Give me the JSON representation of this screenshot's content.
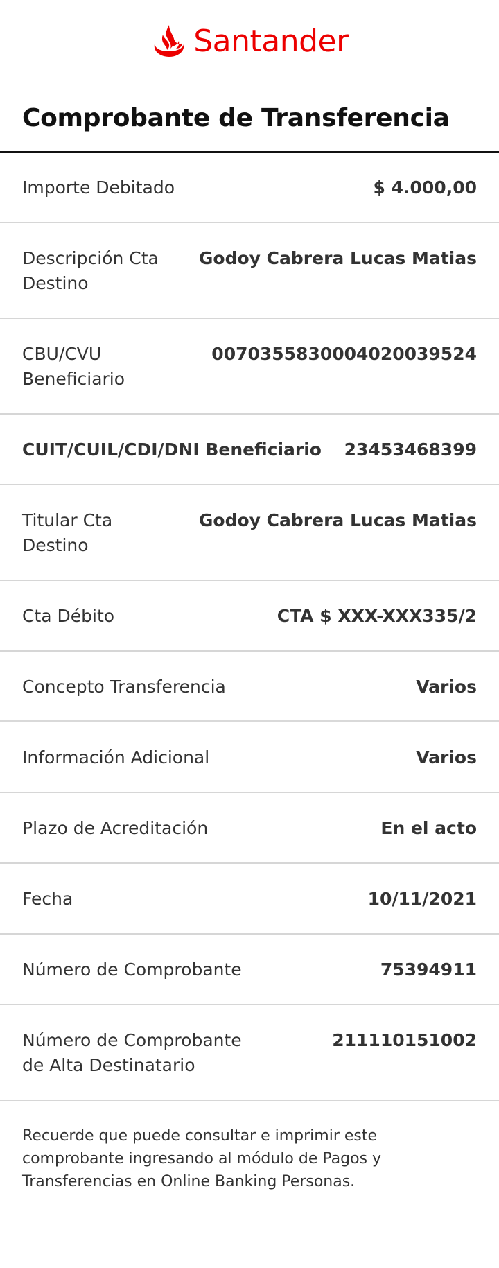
{
  "brand": {
    "name": "Santander",
    "color": "#ec0000",
    "icon": "santander-flame-icon"
  },
  "title": "Comprobante de Transferencia",
  "rows": [
    {
      "label": "Importe Debitado",
      "value": "$ 4.000,00"
    },
    {
      "label": "Descripción Cta Destino",
      "value": "Godoy Cabrera Lucas Matias"
    },
    {
      "label": "CBU/CVU Beneficiario",
      "value": "0070355830004020039524"
    },
    {
      "label": "CUIT/CUIL/CDI/DNI Beneficiario",
      "value": "23453468399"
    },
    {
      "label": "Titular Cta Destino",
      "value": "Godoy Cabrera Lucas Matias"
    },
    {
      "label": "Cta Débito",
      "value": "CTA $ XXX-XXX335/2"
    },
    {
      "label": "Concepto Transferencia",
      "value": "Varios"
    },
    {
      "label": "Información Adicional",
      "value": "Varios"
    },
    {
      "label": "Plazo de Acreditación",
      "value": "En el acto"
    },
    {
      "label": "Fecha",
      "value": "10/11/2021"
    },
    {
      "label": "Número de Comprobante",
      "value": "75394911"
    },
    {
      "label": "Número de Comprobante de Alta Destinatario",
      "value": "211110151002"
    }
  ],
  "footer_note": "Recuerde que puede consultar e imprimir este comprobante ingresando al módulo de Pagos y Transferencias en Online Banking Personas."
}
